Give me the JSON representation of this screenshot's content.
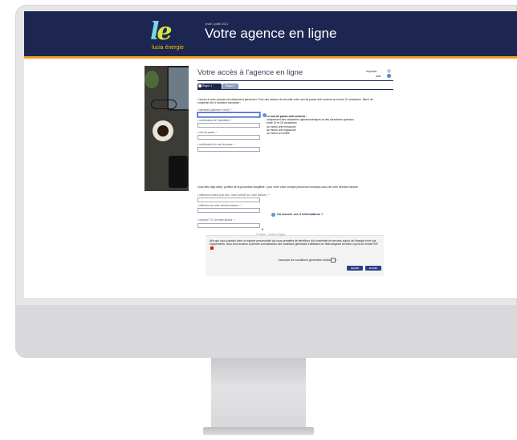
{
  "header": {
    "date": "jeudi 1 juillet 2021",
    "title": "Votre agence en ligne",
    "logo_mark_a": "l",
    "logo_mark_b": "e",
    "logo_text": "lucia énergie"
  },
  "page": {
    "title": "Votre accès à l'agence en ligne",
    "print_link": "imprimer",
    "help_link": "aide"
  },
  "tabs": [
    {
      "label": "Étape 1",
      "color": "#1d2650"
    },
    {
      "label": "Étape 2",
      "color": "#8f99b8"
    }
  ],
  "form": {
    "intro": "L'accès à votre compte est strictement personnel. Pour des raisons de sécurité votre mot de passe doit contenir au moins 10 caractères. Merci de compléter les 4 données suivantes :",
    "fields_account": [
      {
        "label": "identifiant (adresse e-mail)",
        "value": "",
        "active": true
      },
      {
        "label": "confirmation de l'identifiant",
        "value": "",
        "active": false
      },
      {
        "label": "mot de passe",
        "value": "",
        "active": false
      },
      {
        "label": "confirmation du mot de passe",
        "value": "",
        "active": false
      }
    ],
    "required_mark": "*",
    "password_rules": [
      "Le mot de passe doit contenir :",
      "uniquement des caractères alphanumériques et des caractères spéciaux",
      "entre 10 et 25 caractères",
      "au moins une minuscule",
      "au moins une majuscule",
      "au moins un chiffre"
    ],
    "client_intro": "Vous êtes déjà client, profitez de la procédure simplifiée : pour créer votre compte personnel munissez-vous de votre dernière facture.",
    "fields_client": [
      {
        "label": "référence contrat (voir bloc \"votre contrat\" sur votre facture)",
        "value": ""
      },
      {
        "label": "référence de votre dernière facture",
        "value": ""
      },
      {
        "label": "montant TTC de cette facture",
        "value": ""
      }
    ],
    "currency": "€",
    "find_info_link": "Où trouver ces 3 informations ?",
    "terms_text": "Afin que vous puissiez créer un espace personnalisé qui vous permettra de bénéficier d'un ensemble de services autour de l'énergie et de vos équipements, nous vous invitons à prendre connaissance des conditions générales d'utilisation en téléchargeant le fichier ci-joint au format PDF",
    "accept_label": "J'accepte les conditions générales d'utilisation :",
    "accept_checked": false,
    "next_button": "suivant",
    "cancel_button": "annuler"
  },
  "footer": {
    "text": "© Efluid - Ineltiris Digital"
  }
}
